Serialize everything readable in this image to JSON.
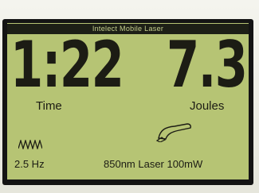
{
  "device": {
    "title": "Intelect Mobile Laser"
  },
  "readouts": {
    "time_value": "1:22",
    "time_label": "Time",
    "joules_value": "7.3",
    "joules_label": "Joules"
  },
  "status": {
    "frequency": "2.5 Hz",
    "laser_info": "850nm Laser 100mW"
  },
  "icons": {
    "frequency": "waveform-icon",
    "laser": "laser-probe-icon"
  },
  "colors": {
    "lcd_background": "#b6c474",
    "lcd_text": "#1c1c14",
    "titlebar_background": "#1d1f16"
  }
}
